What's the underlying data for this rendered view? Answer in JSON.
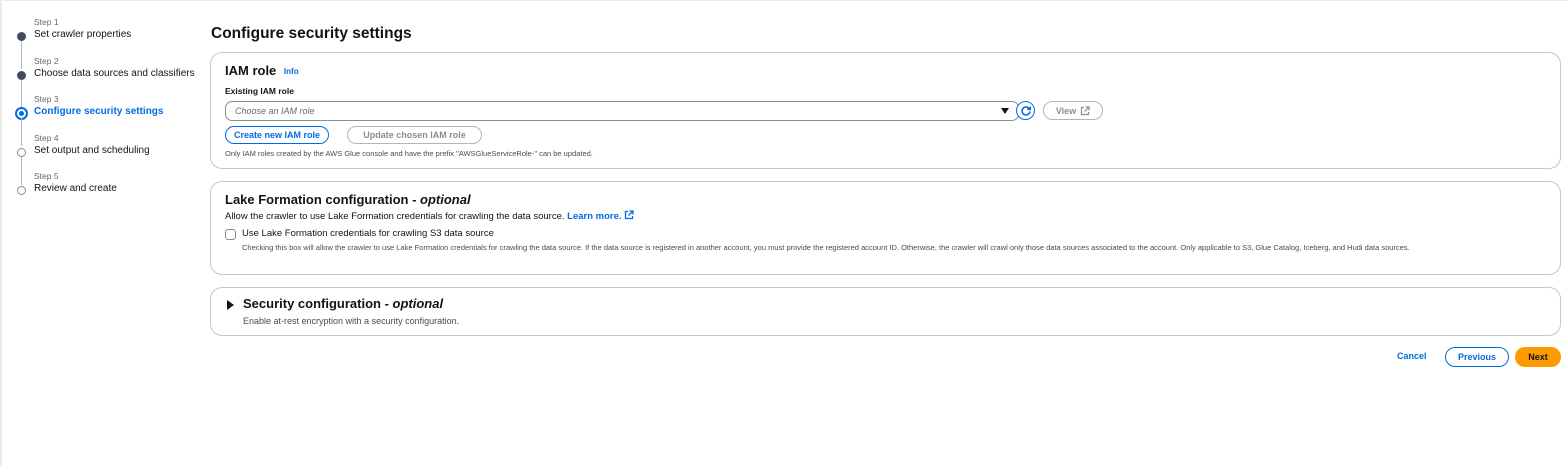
{
  "steps": [
    {
      "num": "Step 1",
      "title": "Set crawler properties",
      "state": "completed"
    },
    {
      "num": "Step 2",
      "title": "Choose data sources and classifiers",
      "state": "completed"
    },
    {
      "num": "Step 3",
      "title": "Configure security settings",
      "state": "current"
    },
    {
      "num": "Step 4",
      "title": "Set output and scheduling",
      "state": "pending"
    },
    {
      "num": "Step 5",
      "title": "Review and create",
      "state": "pending"
    }
  ],
  "main": {
    "title": "Configure security settings"
  },
  "iam": {
    "title": "IAM role",
    "info": "Info",
    "field_label": "Existing IAM role",
    "select_placeholder": "Choose an IAM role",
    "view_label": "View",
    "create_label": "Create new IAM role",
    "update_label": "Update chosen IAM role",
    "help_text": "Only IAM roles created by the AWS Glue console and have the prefix \"AWSGlueServiceRole-\" can be updated."
  },
  "lake": {
    "title": "Lake Formation configuration",
    "optional": "optional",
    "description": "Allow the crawler to use Lake Formation credentials for crawling the data source.",
    "learn_more": "Learn more.",
    "checkbox_label": "Use Lake Formation credentials for crawling S3 data source",
    "checkbox_checked": false,
    "checkbox_description": "Checking this box will allow the crawler to use Lake Formation credentials for crawling the data source. If the data source is registered in another account, you must provide the registered account ID. Otherwise, the crawler will crawl only those data sources associated to the account. Only applicable to S3, Glue Catalog, Iceberg, and Hudi data sources."
  },
  "security": {
    "title": "Security configuration",
    "optional": "optional",
    "description": "Enable at-rest encryption with a security configuration."
  },
  "footer": {
    "cancel_label": "Cancel",
    "previous_label": "Previous",
    "next_label": "Next"
  },
  "colors": {
    "accent": "#006ce0",
    "primary_button": "#ff9900",
    "border": "#c6c6cd",
    "text": "#0f141a"
  },
  "icons": {
    "refresh": "refresh-icon",
    "external": "external-link-icon",
    "caret_down": "caret-down-icon",
    "caret_right": "caret-right-icon"
  }
}
